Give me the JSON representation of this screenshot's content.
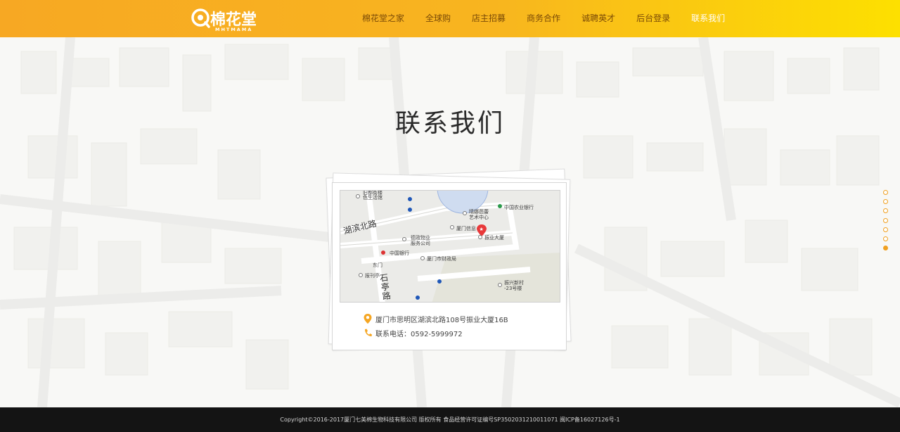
{
  "header": {
    "logo_text": "棉花堂",
    "logo_sub": "MHTMAMA",
    "nav": [
      {
        "label": "棉花堂之家"
      },
      {
        "label": "全球购"
      },
      {
        "label": "店主招募"
      },
      {
        "label": "商务合作"
      },
      {
        "label": "诚聘英才"
      },
      {
        "label": "后台登录"
      },
      {
        "label": "联系我们"
      }
    ]
  },
  "main": {
    "title": "联系我们",
    "map": {
      "roads": [
        "湖滨北路",
        "石亭路"
      ],
      "pois": [
        "旧都街楼",
        "色生活馆",
        "中国农业银行",
        "晴娜芭蕾",
        "艺术中心",
        "厦门信息",
        "振业大厦",
        "德政物业",
        "服务公司",
        "中国银行",
        "厦门市财政局",
        "东门",
        "报刊亭",
        "振兴新村",
        "-23号楼"
      ]
    },
    "address": "厦门市思明区湖滨北路108号振业大厦16B",
    "phone": "联系电话：0592-5999972"
  },
  "pager": {
    "count": 7,
    "active": 6
  },
  "footer": {
    "copyright": "Copyright©2016-2017厦门七美棉生物科技有限公司 版权所有 食品经营许可证编号SP3502031210011071 闽ICP备16027126号-1"
  },
  "colors": {
    "accent": "#f7a823",
    "accent_end": "#fde000",
    "footer_bg": "#141414",
    "pin": "#e8393a"
  }
}
